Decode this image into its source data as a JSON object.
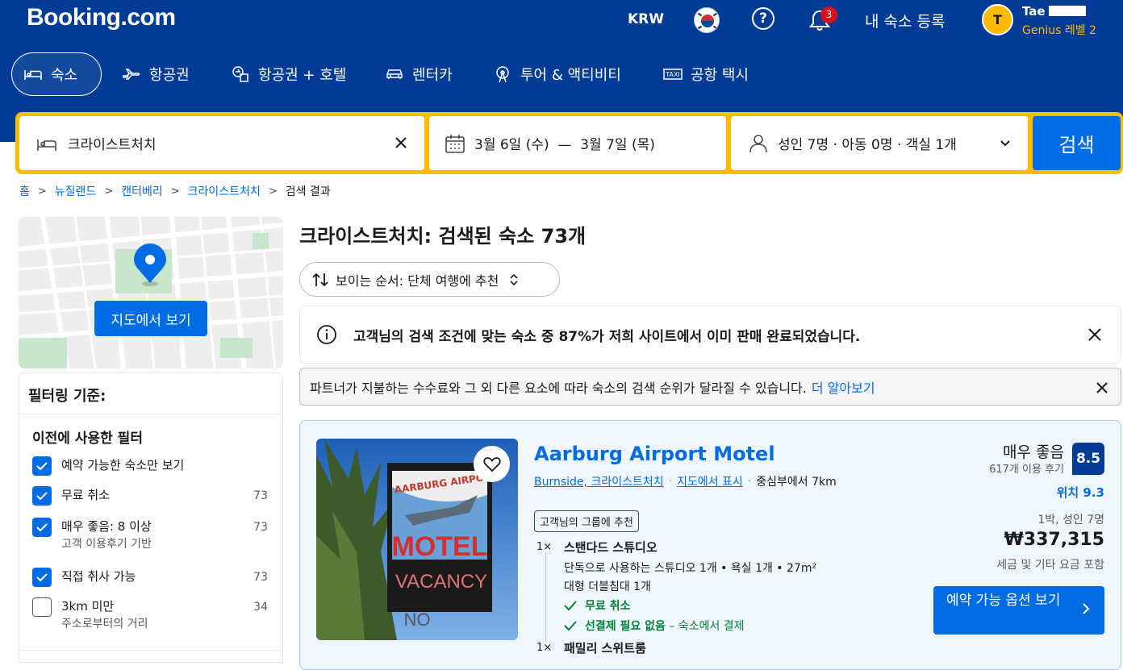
{
  "header": {
    "logo": "Booking.com",
    "currency": "KRW",
    "help_glyph": "?",
    "notification_count": "3",
    "register_label": "내 숙소 등록",
    "avatar_initial": "T",
    "user_name": "Tae                  hoi",
    "genius_level": "Genius 레벨 2"
  },
  "nav": {
    "items": [
      {
        "label": "숙소",
        "icon": "bed-icon"
      },
      {
        "label": "항공권",
        "icon": "plane-icon"
      },
      {
        "label": "항공권 + 호텔",
        "icon": "plane-hotel-icon"
      },
      {
        "label": "렌터카",
        "icon": "car-icon"
      },
      {
        "label": "투어 & 액티비티",
        "icon": "attraction-icon"
      },
      {
        "label": "공항 택시",
        "icon": "taxi-icon"
      }
    ]
  },
  "search": {
    "destination": "크라이스트처치",
    "dates": "3월 6일 (수)  —  3월 7일 (목)",
    "guests": "성인 7명 · 아동 0명 · 객실 1개",
    "button": "검색"
  },
  "breadcrumb": [
    "홈",
    "뉴질랜드",
    "캔터베리",
    "크라이스트처치",
    "검색 결과"
  ],
  "map": {
    "button": "지도에서 보기"
  },
  "filters": {
    "title": "필터링 기준:",
    "section": "이전에 사용한 필터",
    "options": [
      {
        "label": "예약 가능한 숙소만 보기",
        "count": "",
        "sub": "",
        "checked": true
      },
      {
        "label": "무료 취소",
        "count": "73",
        "sub": "",
        "checked": true
      },
      {
        "label": "매우 좋음: 8 이상",
        "count": "73",
        "sub": "고객 이용후기 기반",
        "checked": true
      },
      {
        "label": "직접 취사 가능",
        "count": "73",
        "sub": "",
        "checked": true
      },
      {
        "label": "3km 미만",
        "count": "34",
        "sub": "주소로부터의 거리",
        "checked": false
      }
    ]
  },
  "results": {
    "title": "크라이스트처치: 검색된 숙소 73개",
    "sort_label": "보이는 순서: 단체 여행에 추천",
    "notice": "고객님의 검색 조건에 맞는 숙소 중 87%가 저희 사이트에서 이미 판매 완료되었습니다.",
    "partner_text": "파트너가 지불하는 수수료와 그 외 다른 요소에 따라 숙소의 검색 순위가 달라질 수 있습니다.",
    "partner_link": "더 알아보기"
  },
  "hotel": {
    "name": "Aarburg Airport Motel",
    "area": "Burnside, 크라이스트처치",
    "map_link": "지도에서 표시",
    "distance": "중심부에서 7km",
    "tag": "고객님의 그룹에 추천",
    "photo_sign_top": "AARBURG AIRPO",
    "photo_sign_motel": "MOTEL",
    "photo_sign_vacancy": "VACANCY",
    "photo_sign_no": "NO",
    "rooms": [
      {
        "qty": "1×",
        "name": "스탠다드 스튜디오",
        "desc1": "단독으로 사용하는 스튜디오 1개 • 욕실 1개 • 27m²",
        "desc2": "대형 더블침대 1개"
      },
      {
        "qty": "1×",
        "name": "패밀리 스위트룸"
      }
    ],
    "free_cancel": "무료 취소",
    "no_prepay": "선결제 필요 없음",
    "no_prepay_suffix": "– 숙소에서 결제",
    "rating_word": "매우 좋음",
    "review_count": "617개 이용 후기",
    "score": "8.5",
    "location_score": "위치 9.3",
    "nights_guests": "1박, 성인 7명",
    "price": "₩337,315",
    "tax_note": "세금 및 기타 요금 포함",
    "avail_button": "예약 가능 옵션 보기"
  },
  "colors": {
    "brand": "#003b95",
    "accent": "#febb02",
    "link": "#006ce4",
    "green": "#008234"
  }
}
